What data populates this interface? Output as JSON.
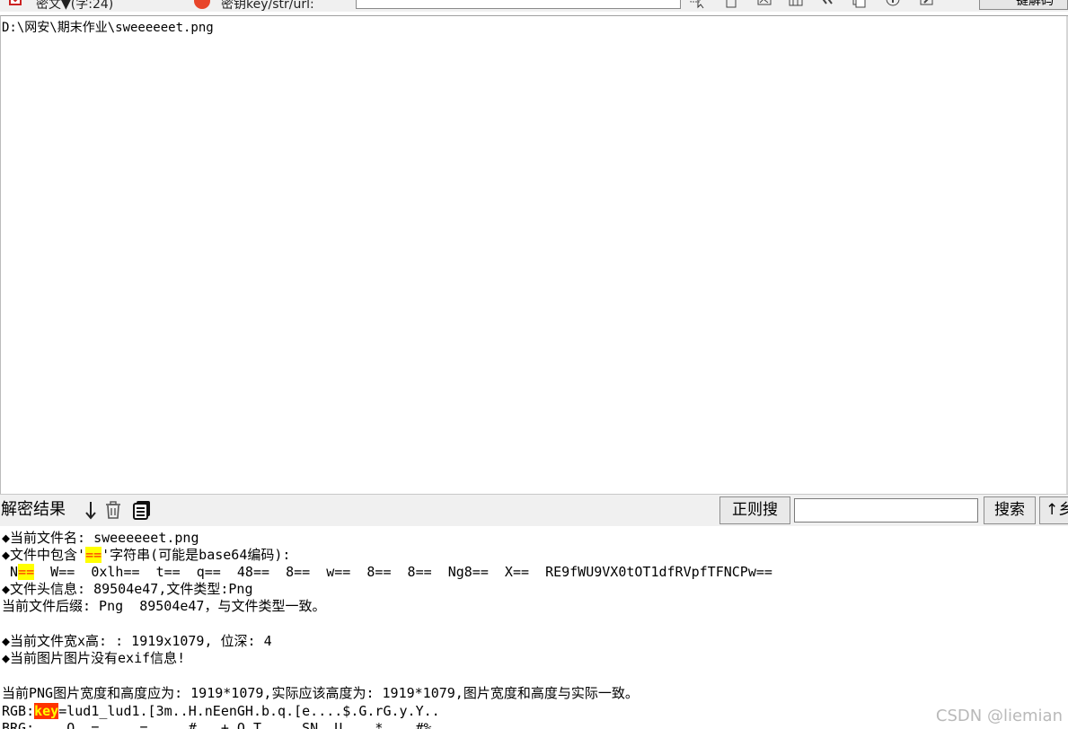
{
  "toolbar": {
    "tab_ciphertext": "密文▼(字:24)",
    "tab_key": "密钥key/str/url:",
    "key_input_value": "",
    "decrypt_button": "键解码"
  },
  "upper": {
    "content": "D:\\网安\\期末作业\\sweeeeeet.png"
  },
  "result_bar": {
    "label": "解密结果",
    "regex_button": "正则搜",
    "regex_input_value": "",
    "search_button": "搜索",
    "up_button": "↑乡"
  },
  "output": {
    "line1": "◆当前文件名: sweeeeeet.png",
    "line2_pre": "◆文件中包含'",
    "line2_hl": "==",
    "line2_post": "'字符串(可能是base64编码):",
    "line3_pre": " N",
    "line3_hl": "==",
    "line3_post": "  W==  0xlh==  t==  q==  48==  8==  w==  8==  8==  Ng8==  X==  RE9fWU9VX0tOT1dfRVpfTFNCPw==",
    "line4": "◆文件头信息: 89504e47,文件类型:Png",
    "line5": "当前文件后缀: Png  89504e47，与文件类型一致。",
    "line6": "◆当前文件宽x高: : 1919x1079, 位深: 4",
    "line7": "◆当前图片图片没有exif信息!",
    "line8": "当前PNG图片宽度和高度应为: 1919*1079,实际应该高度为: 1919*1079,图片宽度和高度与实际一致。",
    "line9_pre": "RGB:",
    "line9_hl": "key",
    "line9_post": "=lud1_lud1.[3m..H.nEenGH.b.q.[e....$.G.rG.y.Y..",
    "line10": "BRG:....Q..=.....=.....#...+.Q.T.....SN..U....*....#%"
  },
  "watermark": "CSDN @liemian",
  "colors": {
    "highlight_yellow": "#ffff00",
    "highlight_red": "#ff3300",
    "toolbar_bg": "#f0f0f0"
  }
}
